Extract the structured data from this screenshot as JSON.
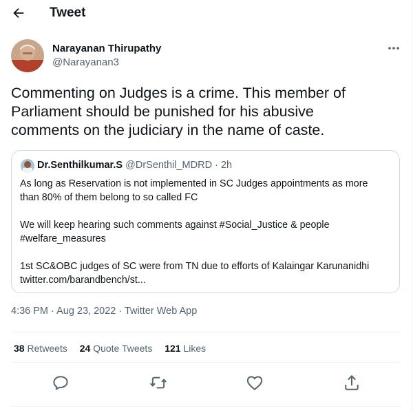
{
  "header": {
    "title": "Tweet"
  },
  "tweet": {
    "author_name": "Narayanan Thirupathy",
    "author_handle": "@Narayanan3",
    "text": "Commenting on Judges is a crime. This member of\nParliament should be punished for his abusive\ncomments on the judiciary in the name of caste.",
    "timestamp": "4:36 PM · Aug 23, 2022",
    "separator": " · ",
    "source": "Twitter Web App"
  },
  "quoted": {
    "author_name": "Dr.Senthilkumar.S",
    "author_handle": "@DrSenthil_MDRD",
    "dot": "·",
    "time": "2h",
    "text": "As long as Reservation is not implemented in SC Judges appointments as more\nthan 80% of them belong to so called FC\n\nWe will keep hearing such comments against #Social_Justice & people\n#welfare_measures\n\n1st SC&OBC judges of SC were from TN due to efforts of Kalaingar Karunanidhi\ntwitter.com/barandbench/st..."
  },
  "stats": {
    "retweets_count": "38",
    "retweets_label": "Retweets",
    "quotes_count": "24",
    "quotes_label": "Quote Tweets",
    "likes_count": "121",
    "likes_label": "Likes"
  },
  "colors": {
    "text": "#0f1419",
    "secondary": "#536471",
    "border": "#cfd9de"
  },
  "icons": [
    "back-arrow-icon",
    "more-options-icon",
    "reply-icon",
    "retweet-icon",
    "like-icon",
    "share-icon"
  ]
}
